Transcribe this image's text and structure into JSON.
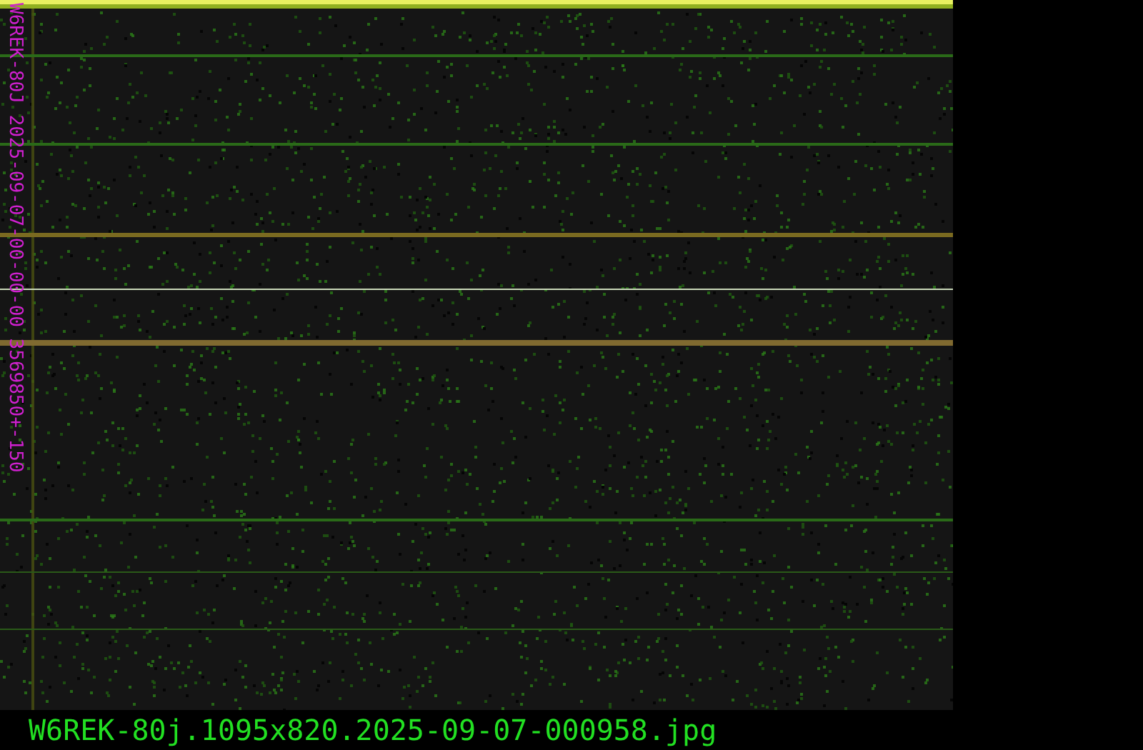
{
  "spectrogram": {
    "side_label": "W6REK-80J 2025-09-07-00-00-00 3569850+-150"
  },
  "caption": {
    "filename": "W6REK-80j.1095x820.2025-09-07-000958.jpg"
  }
}
